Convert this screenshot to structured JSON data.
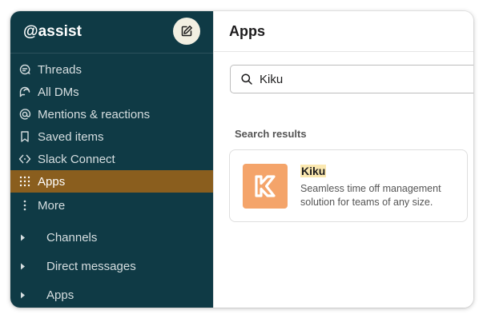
{
  "sidebar": {
    "workspace_name": "@assist",
    "nav_items": [
      {
        "label": "Threads",
        "icon": "threads-icon"
      },
      {
        "label": "All DMs",
        "icon": "dms-icon"
      },
      {
        "label": "Mentions & reactions",
        "icon": "at-icon"
      },
      {
        "label": "Saved items",
        "icon": "bookmark-icon"
      },
      {
        "label": "Slack Connect",
        "icon": "slack-connect-icon"
      },
      {
        "label": "Apps",
        "icon": "apps-grid-icon",
        "active": true
      },
      {
        "label": "More",
        "icon": "more-vertical-icon"
      }
    ],
    "sections": [
      {
        "label": "Channels"
      },
      {
        "label": "Direct messages"
      },
      {
        "label": "Apps"
      }
    ]
  },
  "main": {
    "title": "Apps",
    "search": {
      "value": "Kiku",
      "placeholder": ""
    },
    "results_label": "Search results",
    "results": [
      {
        "name": "Kiku",
        "description": "Seamless time off management solution for teams of any size."
      }
    ]
  },
  "colors": {
    "sidebar_bg": "#0f3a45",
    "active_item_bg": "#8a5e1e",
    "app_logo_bg": "#f4a46a",
    "highlight": "#fbe8b0"
  }
}
